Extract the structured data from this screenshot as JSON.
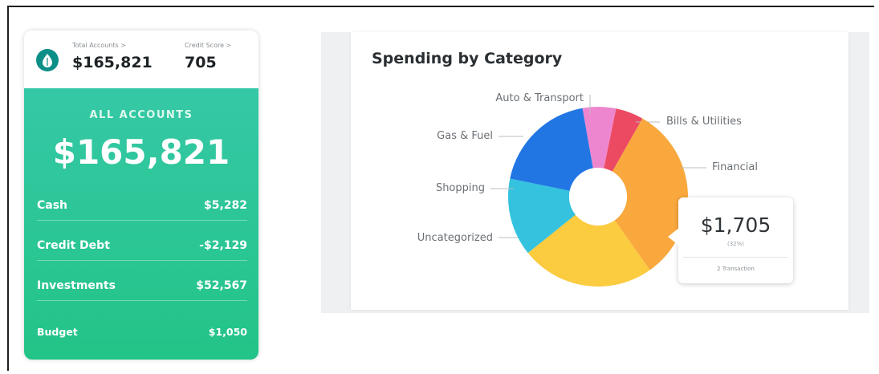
{
  "card": {
    "total_accounts_label": "Total Accounts >",
    "total_accounts_value": "$165,821",
    "credit_score_label": "Credit Score >",
    "credit_score_value": "705",
    "all_accounts_title": "ALL ACCOUNTS",
    "all_accounts_total": "$165,821",
    "rows": [
      {
        "label": "Cash",
        "value": "$5,282"
      },
      {
        "label": "Credit Debt",
        "value": "-$2,129"
      },
      {
        "label": "Investments",
        "value": "$52,567"
      },
      {
        "label": "Budget",
        "value": "$1,050"
      }
    ]
  },
  "spending": {
    "title": "Spending by Category",
    "tooltip": {
      "amount": "$1,705",
      "percent": "(32%)",
      "transactions": "2 Transaction"
    }
  },
  "chart_data": {
    "type": "pie",
    "title": "Spending by Category",
    "slices": [
      {
        "label": "Auto & Transport",
        "value": 6,
        "color": "#ee86cf"
      },
      {
        "label": "Bills & Utilities",
        "value": 5,
        "color": "#ec4a62"
      },
      {
        "label": "Financial",
        "value": 32,
        "color": "#f8a83d"
      },
      {
        "label": "Uncategorized",
        "value": 24,
        "color": "#fbcb40"
      },
      {
        "label": "Shopping",
        "value": 14,
        "color": "#34c2de"
      },
      {
        "label": "Gas & Fuel",
        "value": 19,
        "color": "#2176e4"
      }
    ],
    "center_hole": true
  },
  "colors": {
    "accent_green": "#25c58c",
    "logo_teal": "#0c8f86"
  }
}
